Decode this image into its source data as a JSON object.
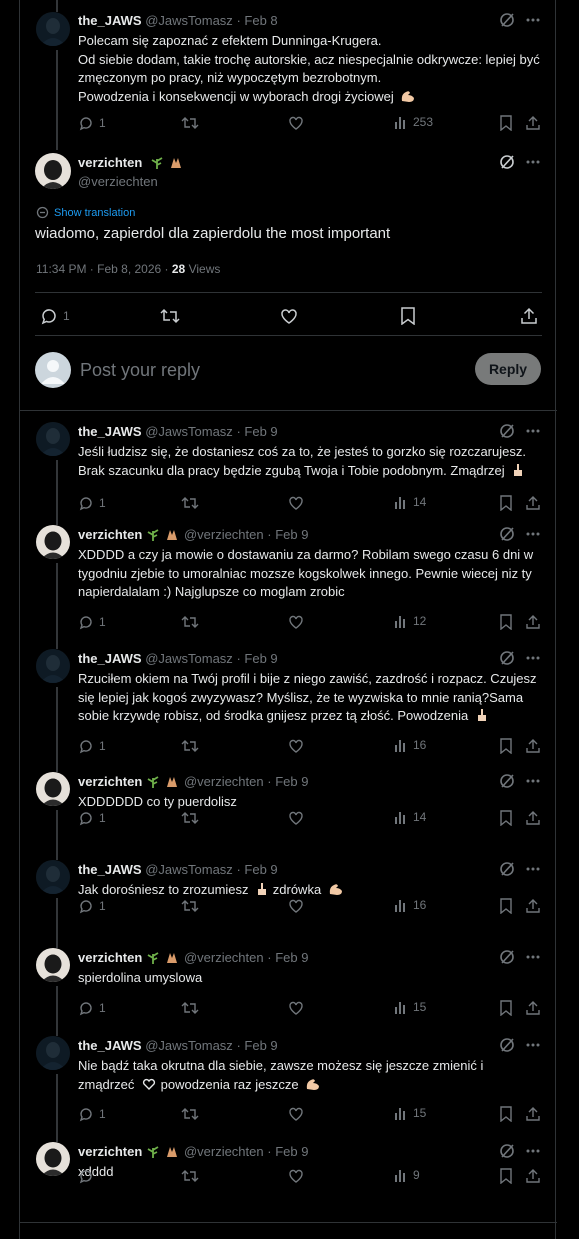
{
  "top_post": {
    "name": "the_JAWS",
    "handle": "@JawsTomasz",
    "date": "Feb 8",
    "text": "Polecam się zapoznać z efektem Dunninga-Krugera.\nOd siebie dodam, takie trochę autorskie, acz niespecjalnie odkrywcze: lepiej być zmęczonym po pracy, niż wypoczętym bezrobotnym.\nPowodzenia i konsekwencji w wyborach drogi życiowej",
    "replies": "1",
    "views": "253"
  },
  "main_post": {
    "name": "verzichten",
    "handle": "@verziechten",
    "show_translation": "Show translation",
    "text": "wiadomo, zapierdol dla zapierdolu the most important",
    "timestamp": "11:34 PM · Feb 8, 2026 ·",
    "views_count": "28",
    "views_label": "Views",
    "replies": "1"
  },
  "composer": {
    "placeholder": "Post your reply",
    "reply_label": "Reply"
  },
  "replies": [
    {
      "name": "the_JAWS",
      "handle": "@JawsTomasz",
      "date": "Feb 9",
      "text": "Jeśli łudzisz się, że dostaniesz coś za to, że jesteś to gorzko się rozczarujesz. Brak szacunku dla pracy będzie zgubą Twoja i Tobie podobnym. Zmądrzej",
      "replies": "1",
      "views": "14"
    },
    {
      "name": "verzichten",
      "handle": "@verziechten",
      "date": "Feb 9",
      "text": "XDDDD a czy ja mowie o dostawaniu za darmo? Robilam swego czasu 6 dni w tygodniu zjebie to umoralniac mozsze kogskolwek innego. Pewnie wiecej niz ty napierdalalam :) Najglupsze co moglam zrobic",
      "replies": "1",
      "views": "12"
    },
    {
      "name": "the_JAWS",
      "handle": "@JawsTomasz",
      "date": "Feb 9",
      "text": "Rzuciłem okiem na Twój profil i bije z niego zawiść, zazdrość i rozpacz. Czujesz się lepiej jak kogoś zwyzywasz? Myślisz, że te wyzwiska to mnie ranią?Sama sobie krzywdę robisz, od środka gnijesz przez tą złość. Powodzenia",
      "replies": "1",
      "views": "16"
    },
    {
      "name": "verzichten",
      "handle": "@verziechten",
      "date": "Feb 9",
      "text": "XDDDDDD co ty puerdolisz",
      "replies": "1",
      "views": "14"
    },
    {
      "name": "the_JAWS",
      "handle": "@JawsTomasz",
      "date": "Feb 9",
      "text": "Jak dorośniesz to zrozumiesz",
      "text_suffix": "zdrówka",
      "replies": "1",
      "views": "16"
    },
    {
      "name": "verzichten",
      "handle": "@verziechten",
      "date": "Feb 9",
      "text": "spierdolina umyslowa",
      "replies": "1",
      "views": "15"
    },
    {
      "name": "the_JAWS",
      "handle": "@JawsTomasz",
      "date": "Feb 9",
      "text": "Nie bądź taka okrutna dla siebie, zawsze możesz się jeszcze zmienić i zmądrzeć",
      "text_suffix": "powodzenia raz jeszcze",
      "replies": "1",
      "views": "15"
    },
    {
      "name": "verzichten",
      "handle": "@verziechten",
      "date": "Feb 9",
      "text": "xdddd",
      "replies": "",
      "views": "9"
    }
  ],
  "colors": {
    "background": "#000000",
    "text": "#e7e9ea",
    "muted": "#71767b",
    "link": "#1d9bf0",
    "border": "#2f3336",
    "reply_button": "#787a7a"
  }
}
